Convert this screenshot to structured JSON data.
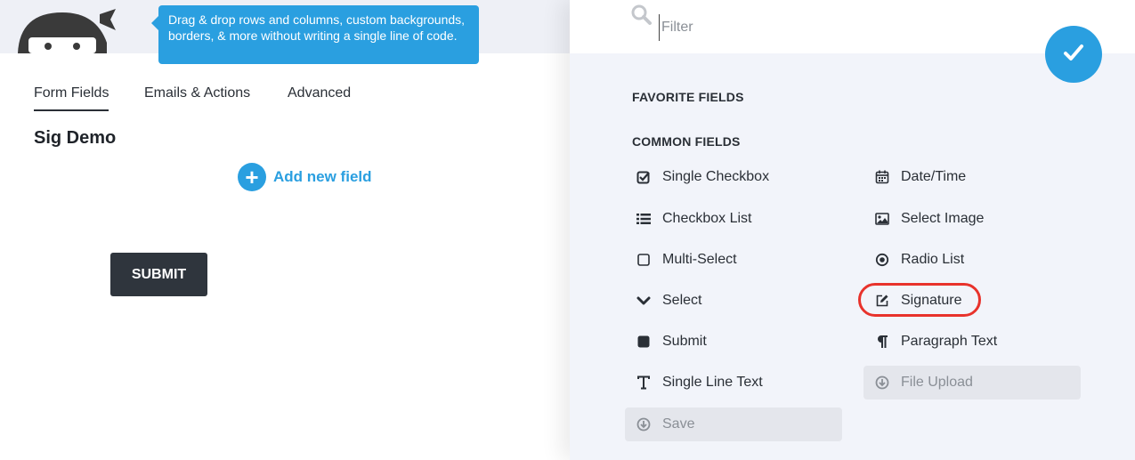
{
  "tooltip": {
    "text": "Drag & drop rows and columns, custom backgrounds, borders, & more without writing a single line of code."
  },
  "tabs": [
    {
      "label": "Form Fields",
      "active": true
    },
    {
      "label": "Emails & Actions",
      "active": false
    },
    {
      "label": "Advanced",
      "active": false
    }
  ],
  "form": {
    "title": "Sig Demo",
    "add_field_label": "Add new field",
    "submit_label": "SUBMIT"
  },
  "drawer": {
    "filter_placeholder": "Filter",
    "favorite_heading": "FAVORITE FIELDS",
    "common_heading": "COMMON FIELDS",
    "left_column": [
      {
        "label": "Single Checkbox",
        "icon": "checkbox-checked-icon",
        "disabled": false
      },
      {
        "label": "Checkbox List",
        "icon": "list-icon",
        "disabled": false
      },
      {
        "label": "Multi-Select",
        "icon": "square-outline-icon",
        "disabled": false
      },
      {
        "label": "Select",
        "icon": "chevron-down-icon",
        "disabled": false
      },
      {
        "label": "Submit",
        "icon": "square-filled-icon",
        "disabled": false
      },
      {
        "label": "Single Line Text",
        "icon": "text-cursor-icon",
        "disabled": false
      },
      {
        "label": "Save",
        "icon": "download-circle-icon",
        "disabled": true
      }
    ],
    "right_column": [
      {
        "label": "Date/Time",
        "icon": "calendar-icon",
        "disabled": false
      },
      {
        "label": "Select Image",
        "icon": "image-icon",
        "disabled": false
      },
      {
        "label": "Radio List",
        "icon": "radio-dot-icon",
        "disabled": false
      },
      {
        "label": "Signature",
        "icon": "edit-pen-icon",
        "disabled": false,
        "highlighted": true
      },
      {
        "label": "Paragraph Text",
        "icon": "paragraph-icon",
        "disabled": false
      },
      {
        "label": "File Upload",
        "icon": "download-circle-icon",
        "disabled": true
      }
    ]
  },
  "colors": {
    "accent": "#2a9fe0",
    "dark_button": "#2f353d",
    "highlight_ring": "#e8322b"
  }
}
